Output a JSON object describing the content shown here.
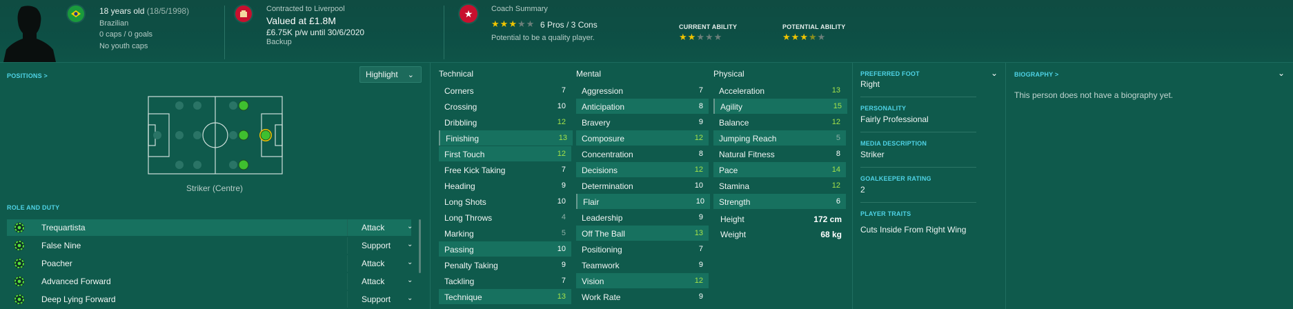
{
  "header": {
    "age_text": "18 years old",
    "dob": "(18/5/1998)",
    "nationality": "Brazilian",
    "caps": "0 caps / 0 goals",
    "youth_caps": "No youth caps",
    "contract_to": "Contracted to Liverpool",
    "valued": "Valued at £1.8M",
    "wage": "£6.75K p/w until 30/6/2020",
    "squad_status": "Backup",
    "coach_summary_title": "Coach Summary",
    "coach_stars": 3,
    "pros_cons": "6 Pros / 3 Cons",
    "potential_text": "Potential to be a quality player.",
    "current_ability_label": "CURRENT ABILITY",
    "current_ability_stars": 2,
    "potential_ability_label": "POTENTIAL ABILITY",
    "potential_ability_stars": 3.5,
    "colors": {
      "brazil_flag": "#1a9a3c",
      "club_red": "#c8102e",
      "star_gold": "#f0c400"
    }
  },
  "positions": {
    "label": "POSITIONS >",
    "highlight_label": "Highlight",
    "position_name": "Striker (Centre)"
  },
  "roles": {
    "label": "ROLE AND DUTY",
    "items": [
      {
        "name": "Trequartista",
        "duty": "Attack"
      },
      {
        "name": "False Nine",
        "duty": "Support"
      },
      {
        "name": "Poacher",
        "duty": "Attack"
      },
      {
        "name": "Advanced Forward",
        "duty": "Attack"
      },
      {
        "name": "Deep Lying Forward",
        "duty": "Support"
      }
    ]
  },
  "attributes": {
    "technical_label": "Technical",
    "mental_label": "Mental",
    "physical_label": "Physical",
    "technical": [
      {
        "name": "Corners",
        "value": "7"
      },
      {
        "name": "Crossing",
        "value": "10"
      },
      {
        "name": "Dribbling",
        "value": "12"
      },
      {
        "name": "Finishing",
        "value": "13"
      },
      {
        "name": "First Touch",
        "value": "12"
      },
      {
        "name": "Free Kick Taking",
        "value": "7"
      },
      {
        "name": "Heading",
        "value": "9"
      },
      {
        "name": "Long Shots",
        "value": "10"
      },
      {
        "name": "Long Throws",
        "value": "4"
      },
      {
        "name": "Marking",
        "value": "5"
      },
      {
        "name": "Passing",
        "value": "10"
      },
      {
        "name": "Penalty Taking",
        "value": "9"
      },
      {
        "name": "Tackling",
        "value": "7"
      },
      {
        "name": "Technique",
        "value": "13"
      }
    ],
    "mental": [
      {
        "name": "Aggression",
        "value": "7"
      },
      {
        "name": "Anticipation",
        "value": "8"
      },
      {
        "name": "Bravery",
        "value": "9"
      },
      {
        "name": "Composure",
        "value": "12"
      },
      {
        "name": "Concentration",
        "value": "8"
      },
      {
        "name": "Decisions",
        "value": "12"
      },
      {
        "name": "Determination",
        "value": "10"
      },
      {
        "name": "Flair",
        "value": "10"
      },
      {
        "name": "Leadership",
        "value": "9"
      },
      {
        "name": "Off The Ball",
        "value": "13"
      },
      {
        "name": "Positioning",
        "value": "7"
      },
      {
        "name": "Teamwork",
        "value": "9"
      },
      {
        "name": "Vision",
        "value": "12"
      },
      {
        "name": "Work Rate",
        "value": "9"
      }
    ],
    "physical": [
      {
        "name": "Acceleration",
        "value": "13"
      },
      {
        "name": "Agility",
        "value": "15"
      },
      {
        "name": "Balance",
        "value": "12"
      },
      {
        "name": "Jumping Reach",
        "value": "5"
      },
      {
        "name": "Natural Fitness",
        "value": "8"
      },
      {
        "name": "Pace",
        "value": "14"
      },
      {
        "name": "Stamina",
        "value": "12"
      },
      {
        "name": "Strength",
        "value": "6"
      }
    ],
    "height_label": "Height",
    "height": "172 cm",
    "weight_label": "Weight",
    "weight": "68 kg"
  },
  "info": {
    "preferred_foot_label": "PREFERRED FOOT",
    "preferred_foot": "Right",
    "personality_label": "PERSONALITY",
    "personality": "Fairly Professional",
    "media_label": "MEDIA DESCRIPTION",
    "media": "Striker",
    "gk_label": "GOALKEEPER RATING",
    "gk": "2",
    "traits_label": "PLAYER TRAITS",
    "traits": "Cuts Inside From Right Wing"
  },
  "biography": {
    "label": "BIOGRAPHY >",
    "text": "This person does not have a biography yet."
  }
}
